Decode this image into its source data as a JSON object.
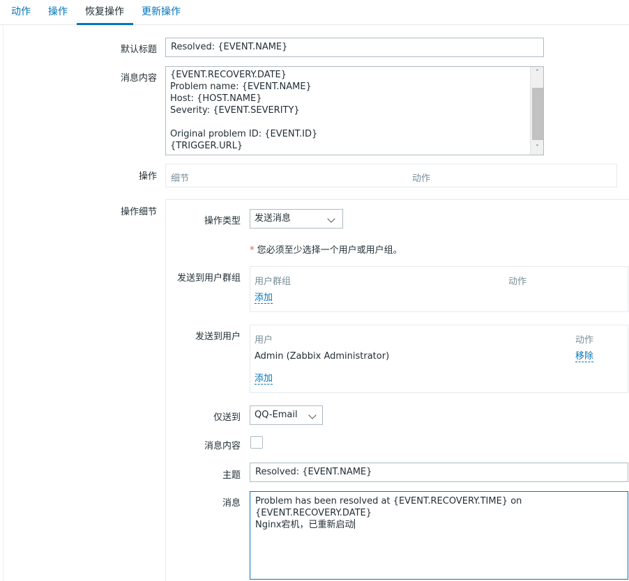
{
  "tabs": [
    {
      "label": "动作",
      "active": false
    },
    {
      "label": "操作",
      "active": false
    },
    {
      "label": "恢复操作",
      "active": true
    },
    {
      "label": "更新操作",
      "active": false
    }
  ],
  "form": {
    "default_subject_label": "默认标题",
    "default_subject_value": "Resolved: {EVENT.NAME}",
    "default_message_label": "消息内容",
    "default_message_lines": [
      "{EVENT.RECOVERY.DATE}",
      "Problem name: {EVENT.NAME}",
      "Host: {HOST.NAME}",
      "Severity: {EVENT.SEVERITY}",
      "",
      "Original problem ID: {EVENT.ID}",
      "{TRIGGER.URL}"
    ],
    "operations_label": "操作",
    "operations_table": {
      "col_details": "细节",
      "col_action": "动作"
    },
    "operation_details_label": "操作细节"
  },
  "op_details": {
    "op_type_label": "操作类型",
    "op_type_value": "发送消息",
    "required_star": "*",
    "required_note": "您必须至少选择一个用户或用户组。",
    "send_to_groups_label": "发送到用户群组",
    "groups_table": {
      "col_group": "用户群组",
      "col_action": "动作",
      "add_link": "添加"
    },
    "send_to_users_label": "发送到用户",
    "users_table": {
      "col_user": "用户",
      "col_action": "动作",
      "rows": [
        {
          "user": "Admin (Zabbix Administrator)",
          "action": "移除"
        }
      ],
      "add_link": "添加"
    },
    "send_only_to_label": "仅送到",
    "send_only_to_value": "QQ-Email",
    "default_message_label": "消息内容",
    "default_message_checked": false,
    "subject_label": "主题",
    "subject_value": "Resolved: {EVENT.NAME}",
    "message_label": "消息",
    "message_lines": [
      "Problem has been resolved at {EVENT.RECOVERY.TIME} on",
      "{EVENT.RECOVERY.DATE}",
      "Nginx宕机，已重新启动"
    ]
  },
  "icons": {
    "scroll_up": "chevron-up-icon",
    "scroll_down": "chevron-down-icon",
    "select_arrow": "chevron-down-icon"
  },
  "colors": {
    "link": "#0275b8",
    "required": "#e45959",
    "focus_border": "#0275b8"
  }
}
